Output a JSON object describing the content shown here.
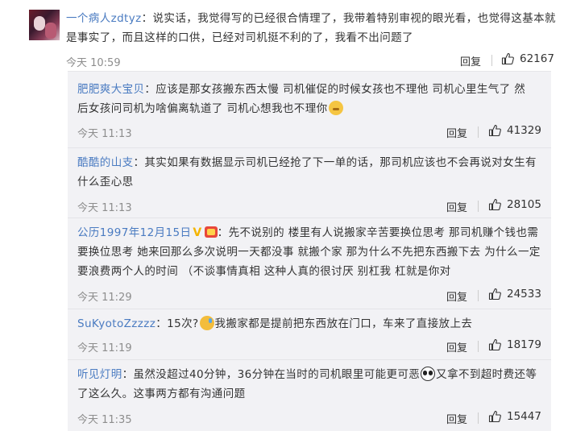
{
  "main_comment": {
    "username": "一个病人zdtyz",
    "line1": "：说实话，我觉得写的已经很合情理了，我带着特别审视的眼光看，也觉得这基本就",
    "line2": "是事实了，而且这样的口供，已经对司机挺不利的了，我看不出问题了",
    "time": "今天 10:59",
    "reply_label": "回复",
    "likes": "62167"
  },
  "replies": [
    {
      "username": "肥肥爽大宝贝",
      "line1": "：应该是那女孩搬东西太慢 司机催促的时候女孩也不理他 司机心里生气了 然",
      "line2": "后女孩问司机为啥偏离轨道了 司机心想我也不理你",
      "emoji": "sweat-emoji",
      "time": "今天 11:13",
      "reply_label": "回复",
      "likes": "41329"
    },
    {
      "username": "酷酷的山支",
      "line1": "：其实如果有数据显示司机已经抢了下一单的话，那司机应该也不会再说对女生有",
      "line2": "什么歪心思",
      "time": "今天 11:13",
      "reply_label": "回复",
      "likes": "28105"
    },
    {
      "username": "公历1997年12月15日",
      "line1": "：先不说别的 楼里有人说搬家辛苦要换位思考 那司机赚个钱也需",
      "line2": "要换位思考 她来回那么多次说明一天都没事 就搬个家 那为什么不先把东西搬下去 为什么一定",
      "line3": "要浪费两个人的时间 （不谈事情真相 这种人真的很讨厌 别杠我 杠就是你对",
      "badge": "V",
      "time": "今天 11:29",
      "reply_label": "回复",
      "likes": "24533"
    },
    {
      "username": "SuKyotoZzzzz",
      "line1a": "：15次?",
      "line1b": "我搬家都是提前把东西放在门口，车来了直接放上去",
      "emoji": "sad-emoji",
      "time": "今天 11:19",
      "reply_label": "回复",
      "likes": "18179"
    },
    {
      "username": "听见灯明",
      "line1a": "：虽然没超过40分钟，36分钟在当时的司机眼里可能更可恶",
      "line1b": "又拿不到超时费还等",
      "line2": "了这么久。这事两方都有沟通问题",
      "emoji": "panda-emoji",
      "time": "今天 11:35",
      "reply_label": "回复",
      "likes": "15447"
    }
  ],
  "colors": {
    "link": "#4a7bc1",
    "meta": "#8d8d8d",
    "panel": "#f2f2f5"
  }
}
